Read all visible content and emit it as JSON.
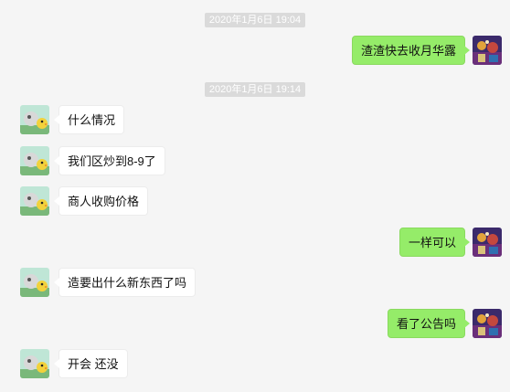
{
  "timestamps": [
    "2020年1月6日 19:04",
    "2020年1月6日 19:14"
  ],
  "messages": [
    {
      "side": "right",
      "text": "渣渣快去收月华露"
    },
    {
      "side": "left",
      "text": "什么情况"
    },
    {
      "side": "left",
      "text": "我们区炒到8-9了"
    },
    {
      "side": "left",
      "text": "商人收购价格"
    },
    {
      "side": "right",
      "text": "一样可以"
    },
    {
      "side": "left",
      "text": "造要出什么新东西了吗"
    },
    {
      "side": "right",
      "text": "看了公告吗"
    },
    {
      "side": "left",
      "text": "开会 还没"
    }
  ],
  "colors": {
    "background": "#f5f5f5",
    "timestamp_bg": "#dadada",
    "self_bubble": "#95ec69",
    "other_bubble": "#ffffff"
  }
}
